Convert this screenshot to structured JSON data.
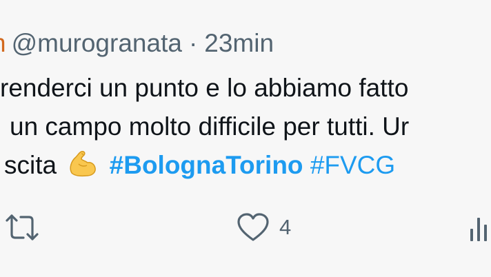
{
  "tweet": {
    "name_fragment": "n",
    "handle": "@murogranata",
    "separator": "·",
    "time": "23min",
    "lines": [
      "renderci un punto e lo abbiamo fatto",
      "un campo molto difficile per tutti. Ur",
      "scita"
    ],
    "emoji": "flexed-biceps",
    "hashtags": [
      "#BolognaTorino",
      "#FVCG"
    ]
  },
  "actions": {
    "like_count": "4"
  },
  "colors": {
    "background": "#f7f7f7",
    "text": "#0f1419",
    "muted": "#536471",
    "link": "#1d9bf0"
  }
}
